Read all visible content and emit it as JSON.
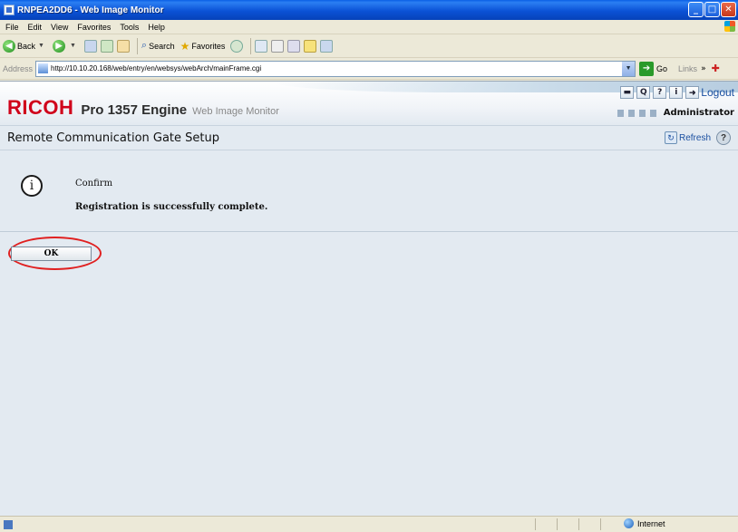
{
  "window": {
    "title": "RNPEA2DD6 - Web Image Monitor"
  },
  "menu": [
    "File",
    "Edit",
    "View",
    "Favorites",
    "Tools",
    "Help"
  ],
  "toolbar": {
    "back": "Back",
    "search": "Search",
    "favorites": "Favorites"
  },
  "address": {
    "label": "Address",
    "url": "http://10.10.20.168/web/entry/en/websys/webArch/mainFrame.cgi",
    "go": "Go",
    "links": "Links"
  },
  "header": {
    "brand": "RICOH",
    "model": "Pro 1357 Engine",
    "product": "Web Image Monitor",
    "logout": "Logout",
    "user": "Administrator",
    "help_glyph": "?",
    "info_glyph": "i",
    "search_glyph": "Q"
  },
  "page": {
    "title": "Remote Communication Gate Setup",
    "refresh": "Refresh",
    "confirm_heading": "Confirm",
    "message": "Registration is successfully complete.",
    "ok_label": "OK",
    "info_symbol": "i"
  },
  "statusbar": {
    "zone": "Internet"
  },
  "colors": {
    "brand_red": "#d0021b",
    "highlight": "#e02020",
    "content_bg": "#e3eaf1"
  }
}
